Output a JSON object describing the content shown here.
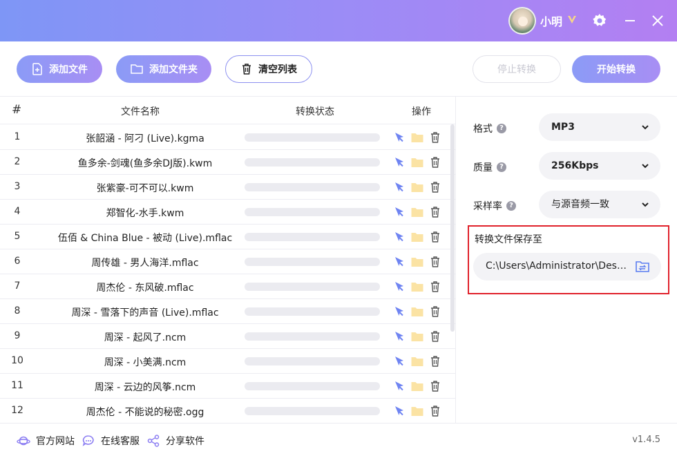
{
  "titlebar": {
    "username": "小明",
    "icons": [
      "avatar",
      "vip-badge-icon",
      "settings-gear-icon",
      "minimize-icon",
      "close-icon"
    ]
  },
  "toolbar": {
    "add_file_label": "添加文件",
    "add_folder_label": "添加文件夹",
    "clear_list_label": "清空列表",
    "stop_label": "停止转换",
    "start_label": "开始转换"
  },
  "list": {
    "headers": {
      "num": "#",
      "name": "文件名称",
      "status": "转换状态",
      "ops": "操作"
    },
    "rows": [
      {
        "num": "1",
        "name": "张韶涵 - 阿刁 (Live).kgma",
        "progress": 0
      },
      {
        "num": "2",
        "name": "鱼多余-剑魂(鱼多余DJ版).kwm",
        "progress": 0
      },
      {
        "num": "3",
        "name": "张紫豪-可不可以.kwm",
        "progress": 0
      },
      {
        "num": "4",
        "name": "郑智化-水手.kwm",
        "progress": 0
      },
      {
        "num": "5",
        "name": "伍佰 & China Blue - 被动 (Live).mflac",
        "progress": 0
      },
      {
        "num": "6",
        "name": "周传雄 - 男人海洋.mflac",
        "progress": 0
      },
      {
        "num": "7",
        "name": "周杰伦 - 东风破.mflac",
        "progress": 0
      },
      {
        "num": "8",
        "name": "周深 - 雪落下的声音 (Live).mflac",
        "progress": 0
      },
      {
        "num": "9",
        "name": "周深 - 起风了.ncm",
        "progress": 0
      },
      {
        "num": "10",
        "name": "周深 - 小美满.ncm",
        "progress": 0
      },
      {
        "num": "11",
        "name": "周深 - 云边的风筝.ncm",
        "progress": 0
      },
      {
        "num": "12",
        "name": "周杰伦 - 不能说的秘密.ogg",
        "progress": 0
      }
    ]
  },
  "settings": {
    "format": {
      "label": "格式",
      "value": "MP3"
    },
    "quality": {
      "label": "质量",
      "value": "256Kbps"
    },
    "samplerate": {
      "label": "采样率",
      "value": "与源音频一致"
    },
    "save": {
      "label": "转换文件保存至",
      "path": "C:\\Users\\Administrator\\Desktop"
    }
  },
  "footer": {
    "website_label": "官方网站",
    "service_label": "在线客服",
    "share_label": "分享软件",
    "version": "v1.4.5"
  },
  "colors": {
    "accent_start": "#8b9bf6",
    "accent_end": "#a88ef4",
    "highlight_border": "#e0202a",
    "folder": "#fbe3a4",
    "pin": "#6f84f2"
  }
}
